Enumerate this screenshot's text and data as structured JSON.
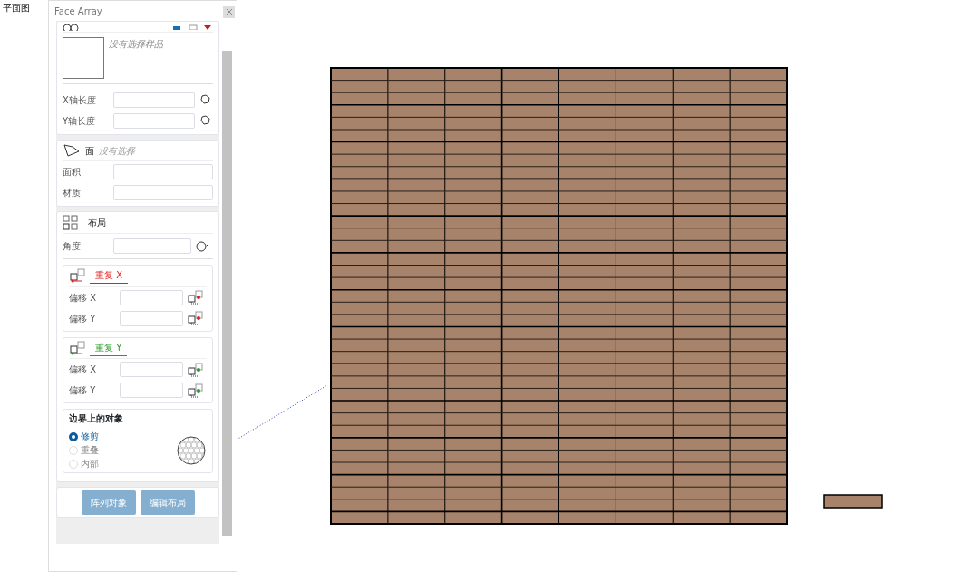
{
  "view_label": "平面图",
  "panel": {
    "title": "Face Array",
    "sample": {
      "empty_text": "没有选择样品",
      "fields": [
        {
          "label": "X轴长度"
        },
        {
          "label": "Y轴长度"
        }
      ]
    },
    "face": {
      "title": "面",
      "status": "没有选择",
      "fields": [
        {
          "label": "面积"
        },
        {
          "label": "材质"
        }
      ]
    },
    "layout": {
      "title": "布局",
      "angle_label": "角度",
      "repeat_x": {
        "title": "重复 X",
        "fields": [
          {
            "label": "偏移 X"
          },
          {
            "label": "偏移 Y"
          }
        ]
      },
      "repeat_y": {
        "title": "重复 Y",
        "fields": [
          {
            "label": "偏移 X"
          },
          {
            "label": "偏移 Y"
          }
        ]
      },
      "boundary": {
        "title": "边界上的对象",
        "options": [
          {
            "label": "修剪",
            "selected": true
          },
          {
            "label": "重叠",
            "selected": false
          },
          {
            "label": "内部",
            "selected": false
          }
        ]
      }
    },
    "buttons": [
      "阵列对象",
      "编辑布局"
    ]
  }
}
